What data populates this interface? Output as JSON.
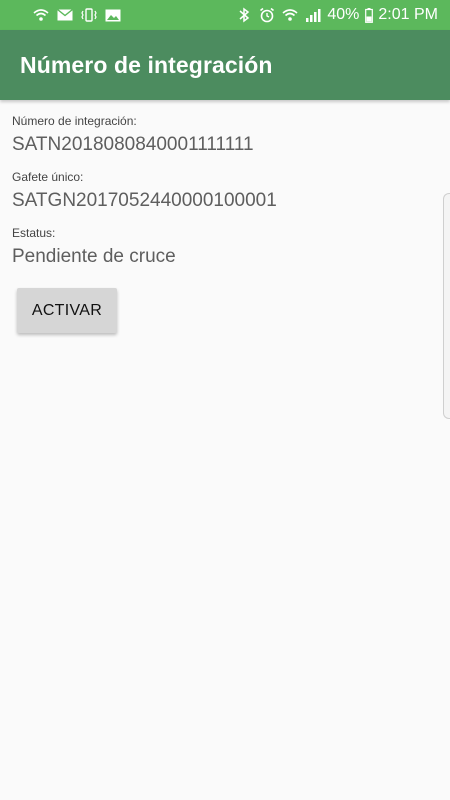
{
  "status_bar": {
    "battery_percent": "40%",
    "time": "2:01 PM",
    "left_icons": [
      "wifi-call-icon",
      "mail-icon",
      "vibrate-icon",
      "image-icon"
    ],
    "right_icons": [
      "bluetooth-icon",
      "alarm-icon",
      "wifi-icon",
      "signal-icon",
      "battery-icon"
    ]
  },
  "appbar": {
    "title": "Número de integración"
  },
  "fields": [
    {
      "label": "Número de integración:",
      "value": "SATN2018080840001111111"
    },
    {
      "label": "Gafete único:",
      "value": "SATGN2017052440000100001"
    },
    {
      "label": "Estatus:",
      "value": "Pendiente de cruce"
    }
  ],
  "actions": {
    "activate_label": "ACTIVAR"
  },
  "colors": {
    "status_bar": "#5cb85c",
    "appbar": "#4c8c5f",
    "background": "#fafafa"
  }
}
